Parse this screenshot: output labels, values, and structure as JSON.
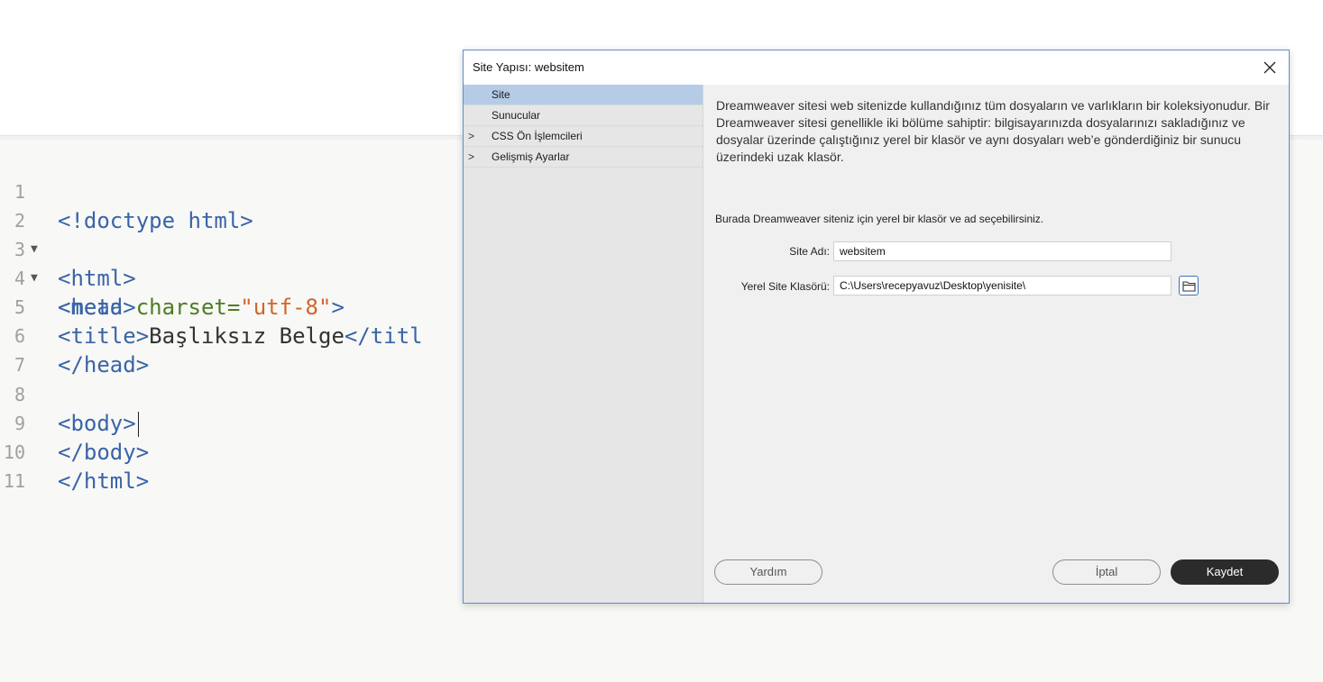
{
  "editor": {
    "lines": [
      {
        "num": "1"
      },
      {
        "num": "2",
        "fold": "▼"
      },
      {
        "num": "3",
        "fold": "▼"
      },
      {
        "num": "4"
      },
      {
        "num": "5"
      },
      {
        "num": "6"
      },
      {
        "num": "7"
      },
      {
        "num": "8"
      },
      {
        "num": "9"
      },
      {
        "num": "10"
      },
      {
        "num": "11"
      }
    ],
    "code": {
      "l1": "<!doctype html>",
      "l2": "<html>",
      "l3": "<head>",
      "l4_open": "<meta ",
      "l4_attr": "charset=",
      "l4_val": "\"utf-8\"",
      "l4_close": ">",
      "l5_open": "<title>",
      "l5_text": "Başlıksız Belge",
      "l5_close": "</titl",
      "l6": "</head>",
      "l8": "<body>",
      "l9": "</body>",
      "l10": "</html>"
    }
  },
  "dialog": {
    "title": "Site Yapısı: websitem",
    "close_icon": "close-icon",
    "sidebar": {
      "items": [
        {
          "label": "Site",
          "selected": true
        },
        {
          "label": "Sunucular"
        },
        {
          "label": "CSS Ön İşlemcileri",
          "chevron": ">"
        },
        {
          "label": "Gelişmiş Ayarlar",
          "chevron": ">"
        }
      ]
    },
    "description": "Dreamweaver sitesi web sitenizde kullandığınız tüm dosyaların ve varlıkların bir koleksiyonudur. Bir Dreamweaver sitesi genellikle iki bölüme sahiptir: bilgisayarınızda dosyalarınızı sakladığınız ve dosyalar üzerinde çalıştığınız yerel bir klasör ve aynı dosyaları web’e gönderdiğiniz bir sunucu üzerindeki uzak klasör.",
    "hint": "Burada Dreamweaver siteniz için yerel bir klasör ve ad seçebilirsiniz.",
    "fields": {
      "site_name_label": "Site Adı:",
      "site_name_value": "websitem",
      "local_folder_label": "Yerel Site Klasörü:",
      "local_folder_value": "C:\\Users\\recepyavuz\\Desktop\\yenisite\\"
    },
    "folder_icon": "folder-icon",
    "buttons": {
      "help": "Yardım",
      "cancel": "İptal",
      "save": "Kaydet"
    },
    "colors": {
      "selected_item": "#b5cbe6",
      "primary_button": "#2b2b2b",
      "border_accent": "#5b8fc9"
    }
  }
}
